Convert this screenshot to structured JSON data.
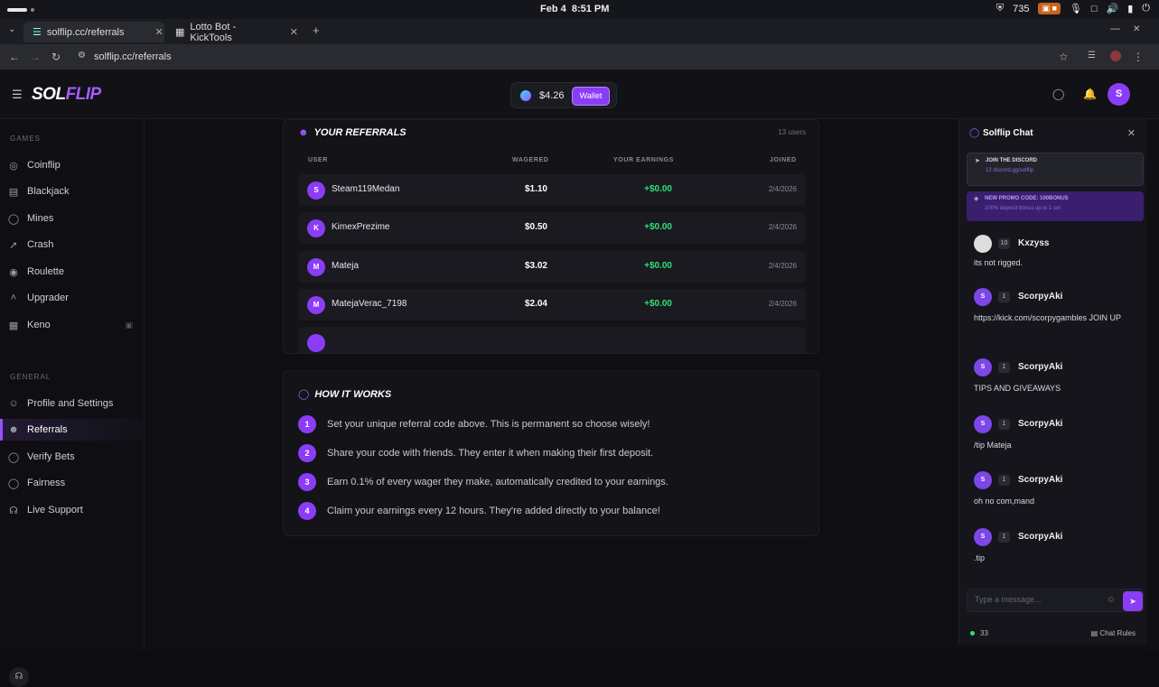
{
  "os": {
    "date": "Feb 4",
    "time": "8:51 PM",
    "shield_count": "735"
  },
  "browser": {
    "tabs": [
      {
        "label": "solflip.cc/referrals"
      },
      {
        "label": "Lotto Bot - KickTools"
      }
    ],
    "url": "solflip.cc/referrals"
  },
  "header": {
    "logo_sol": "SOL",
    "logo_flip": "FLIP",
    "balance": "$4.26",
    "wallet_label": "Wallet",
    "avatar_initial": "S"
  },
  "sidebar": {
    "games_heading": "GAMES",
    "games": [
      {
        "label": "Coinflip",
        "icon": "coin-icon"
      },
      {
        "label": "Blackjack",
        "icon": "cards-icon"
      },
      {
        "label": "Mines",
        "icon": "mine-icon"
      },
      {
        "label": "Crash",
        "icon": "rocket-icon"
      },
      {
        "label": "Roulette",
        "icon": "roulette-icon"
      },
      {
        "label": "Upgrader",
        "icon": "upgrade-icon"
      },
      {
        "label": "Keno",
        "icon": "grid-icon",
        "locked": true
      }
    ],
    "general_heading": "GENERAL",
    "general": [
      {
        "label": "Profile and Settings",
        "icon": "user-icon"
      },
      {
        "label": "Referrals",
        "icon": "users-icon",
        "active": true
      },
      {
        "label": "Verify Bets",
        "icon": "shield-check-icon"
      },
      {
        "label": "Fairness",
        "icon": "shield-icon"
      },
      {
        "label": "Live Support",
        "icon": "headset-icon"
      }
    ]
  },
  "referrals": {
    "title": "YOUR REFERRALS",
    "count": "13 users",
    "columns": {
      "user": "USER",
      "wagered": "WAGERED",
      "earnings": "YOUR EARNINGS",
      "joined": "JOINED"
    },
    "rows": [
      {
        "initial": "S",
        "user": "Steam119Medan",
        "wagered": "$1.10",
        "earnings": "+$0.00",
        "joined": "2/4/2026"
      },
      {
        "initial": "K",
        "user": "KimexPrezime",
        "wagered": "$0.50",
        "earnings": "+$0.00",
        "joined": "2/4/2026"
      },
      {
        "initial": "M",
        "user": "Mateja",
        "wagered": "$3.02",
        "earnings": "+$0.00",
        "joined": "2/4/2026"
      },
      {
        "initial": "M",
        "user": "MatejaVerac_7198",
        "wagered": "$2.04",
        "earnings": "+$0.00",
        "joined": "2/4/2026"
      }
    ]
  },
  "how_it_works": {
    "title": "HOW IT WORKS",
    "steps": [
      {
        "n": "1",
        "text": "Set your unique referral code above. This is permanent so choose wisely!"
      },
      {
        "n": "2",
        "text": "Share your code with friends. They enter it when making their first deposit."
      },
      {
        "n": "3",
        "text": "Earn 0.1% of every wager they make, automatically credited to your earnings."
      },
      {
        "n": "4",
        "text": "Claim your earnings every 12 hours. They're added directly to your balance!"
      }
    ]
  },
  "chat": {
    "title": "Solflip Chat",
    "discord_banner": {
      "title": "JOIN THE DISCORD",
      "sub": "12 discord.gg/solflip"
    },
    "promo_banner": {
      "title": "NEW PROMO CODE: 100BONUS",
      "sub": "100% deposit bonus up to 1 sol"
    },
    "messages": [
      {
        "initial": "",
        "level": "10",
        "user": "Kxzyss",
        "text": "its not rigged."
      },
      {
        "initial": "S",
        "level": "1",
        "user": "ScorpyAki",
        "text": "https://kick.com/scorpygambles JOIN UP"
      },
      {
        "initial": "S",
        "level": "1",
        "user": "ScorpyAki",
        "text": "TIPS AND GIVEAWAYS"
      },
      {
        "initial": "S",
        "level": "1",
        "user": "ScorpyAki",
        "text": "/tip Mateja"
      },
      {
        "initial": "S",
        "level": "1",
        "user": "ScorpyAki",
        "text": "oh no com,mand"
      },
      {
        "initial": "S",
        "level": "1",
        "user": "ScorpyAki",
        "text": ".tip"
      }
    ],
    "input_placeholder": "Type a message...",
    "online_count": "33",
    "rules_label": "Chat Rules"
  }
}
